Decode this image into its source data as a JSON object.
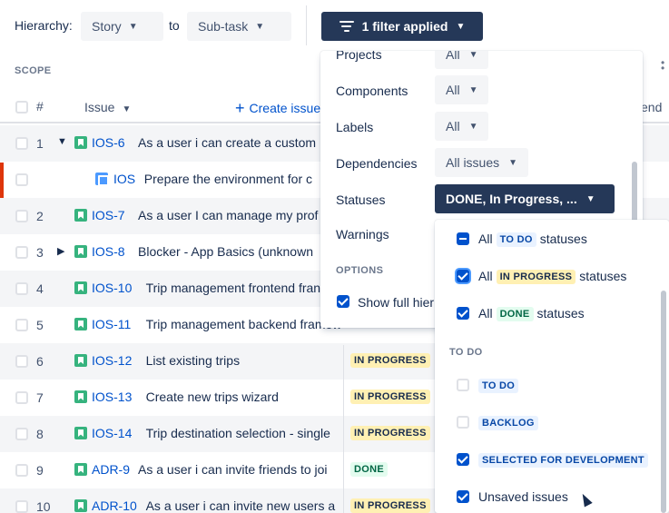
{
  "toolbar": {
    "hierarchy_label": "Hierarchy:",
    "from_value": "Story",
    "to_label": "to",
    "to_value": "Sub-task",
    "filter_button": "1 filter applied"
  },
  "table": {
    "scope_label": "SCOPE",
    "header": {
      "num": "#",
      "issue": "Issue",
      "create": "Create issue",
      "end": "end"
    },
    "rows": [
      {
        "num": "1",
        "expand": "v",
        "icon": "story",
        "key": "IOS-6",
        "summary": "As a user i can create a custom",
        "status": ""
      },
      {
        "num": "",
        "expand": "",
        "icon": "task",
        "key": "IOS",
        "summary": "Prepare the environment for c",
        "status": ""
      },
      {
        "num": "2",
        "expand": "",
        "icon": "story",
        "key": "IOS-7",
        "summary": "As a user I can manage my prof",
        "status": ""
      },
      {
        "num": "3",
        "expand": ">",
        "icon": "story",
        "key": "IOS-8",
        "summary": "Blocker - App Basics (unknown",
        "status": ""
      },
      {
        "num": "4",
        "expand": "",
        "icon": "story",
        "key": "IOS-10",
        "summary": "Trip management frontend fran",
        "status": ""
      },
      {
        "num": "5",
        "expand": "",
        "icon": "story",
        "key": "IOS-11",
        "summary": "Trip management backend framew",
        "status": ""
      },
      {
        "num": "6",
        "expand": "",
        "icon": "story",
        "key": "IOS-12",
        "summary": "List existing trips",
        "status": "IN PROGRESS"
      },
      {
        "num": "7",
        "expand": "",
        "icon": "story",
        "key": "IOS-13",
        "summary": "Create new trips wizard",
        "status": "IN PROGRESS"
      },
      {
        "num": "8",
        "expand": "",
        "icon": "story",
        "key": "IOS-14",
        "summary": "Trip destination selection - single",
        "status": "IN PROGRESS"
      },
      {
        "num": "9",
        "expand": "",
        "icon": "story",
        "key": "ADR-9",
        "summary": "As a user i can invite friends to joi",
        "status": "DONE"
      },
      {
        "num": "10",
        "expand": "",
        "icon": "story",
        "key": "ADR-10",
        "summary": "As a user i can invite new users a",
        "status": "IN PROGRESS"
      }
    ]
  },
  "filter_panel": {
    "projects_label": "Projects",
    "projects_value": "All",
    "components_label": "Components",
    "components_value": "All",
    "labels_label": "Labels",
    "labels_value": "All",
    "dependencies_label": "Dependencies",
    "dependencies_value": "All issues",
    "statuses_label": "Statuses",
    "statuses_value": "DONE, In Progress, ...",
    "warnings_label": "Warnings",
    "options_heading": "OPTIONS",
    "show_full_label": "Show full hier"
  },
  "status_dropdown": {
    "all_word": "All",
    "statuses_word": "statuses",
    "all_todo": {
      "lozenge": "TO DO",
      "state": "indeterminate"
    },
    "all_inprogress": {
      "lozenge": "IN PROGRESS",
      "state": "checked"
    },
    "all_done": {
      "lozenge": "DONE",
      "state": "checked"
    },
    "todo_heading": "TO DO",
    "items": [
      {
        "label": "TO DO",
        "state": "unchecked"
      },
      {
        "label": "BACKLOG",
        "state": "unchecked"
      },
      {
        "label": "SELECTED FOR DEVELOPMENT",
        "state": "checked"
      },
      {
        "label": "Unsaved issues",
        "state": "checked"
      }
    ]
  },
  "colors": {
    "primary_dark": "#253858",
    "link": "#0052cc",
    "story_green": "#36b37e",
    "in_progress_bg": "#fff0b3",
    "done_bg": "#e3fcef",
    "alert_red": "#de350b"
  }
}
